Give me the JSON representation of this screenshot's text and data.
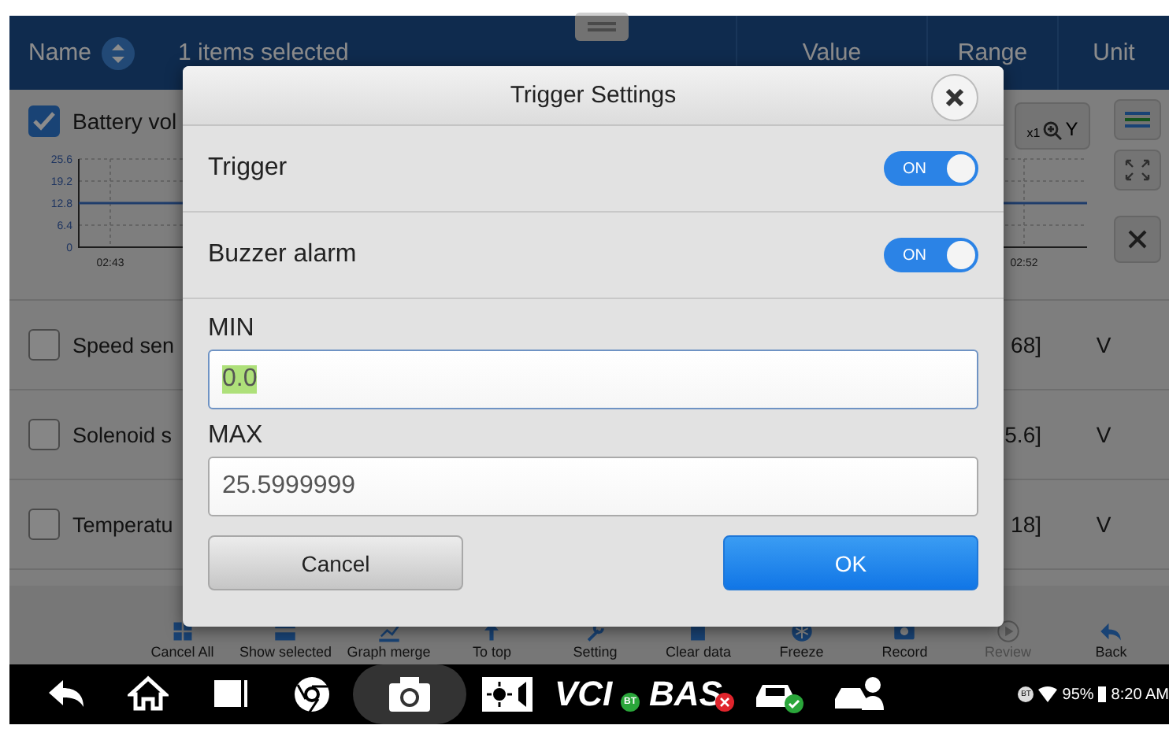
{
  "header": {
    "name_label": "Name",
    "selection": "1 items selected",
    "columns": [
      "Value",
      "Range",
      "Unit"
    ]
  },
  "rows": [
    {
      "kind": "graph",
      "name": "Battery vol",
      "checked": true,
      "graph": {
        "y_ticks": [
          "25.6",
          "19.2",
          "12.8",
          "6.4",
          "0"
        ],
        "x_ticks": [
          "02:43",
          "02:52"
        ]
      }
    },
    {
      "kind": "value",
      "name": "Speed sen",
      "checked": false,
      "range": "68]",
      "unit": "V"
    },
    {
      "kind": "value",
      "name": "Solenoid s",
      "checked": false,
      "range": "5.6]",
      "unit": "V"
    },
    {
      "kind": "value",
      "name": "Temperatu",
      "checked": false,
      "range": "18]",
      "unit": "V"
    }
  ],
  "graph_controls": {
    "zoom": "x1",
    "axis": "Y"
  },
  "dialog": {
    "title": "Trigger Settings",
    "switches": [
      {
        "label": "Trigger",
        "on": true,
        "state_text": "ON"
      },
      {
        "label": "Buzzer alarm",
        "on": true,
        "state_text": "ON"
      }
    ],
    "fields": [
      {
        "label": "MIN",
        "value": "0.0",
        "highlighted": true
      },
      {
        "label": "MAX",
        "value": "25.5999999",
        "highlighted": false
      }
    ],
    "buttons": [
      {
        "label": "Cancel",
        "kind": "secondary"
      },
      {
        "label": "OK",
        "kind": "primary"
      }
    ]
  },
  "toolbar": [
    {
      "label": "Cancel All",
      "disabled": false
    },
    {
      "label": "Show selected",
      "disabled": false
    },
    {
      "label": "Graph merge",
      "disabled": false
    },
    {
      "label": "To top",
      "disabled": false
    },
    {
      "label": "Setting",
      "disabled": false
    },
    {
      "label": "Clear data",
      "disabled": false
    },
    {
      "label": "Freeze",
      "disabled": false
    },
    {
      "label": "Record",
      "disabled": false
    },
    {
      "label": "Review",
      "disabled": true
    },
    {
      "label": "Back",
      "disabled": false
    }
  ],
  "nav_bar": {
    "apps": [
      {
        "label": "VCI",
        "badge": "BT",
        "connected": true
      },
      {
        "label": "BAS",
        "connected": false
      }
    ],
    "status": {
      "bluetooth": "BT",
      "battery": "95%",
      "time": "8:20 AM"
    }
  }
}
